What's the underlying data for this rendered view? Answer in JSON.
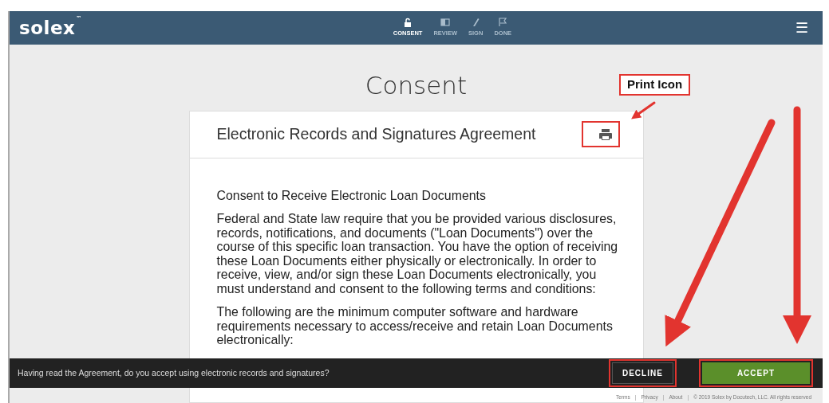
{
  "header": {
    "logo": "solex",
    "trademark": "™",
    "steps": [
      {
        "label": "CONSENT",
        "kind": "lock",
        "selected": true
      },
      {
        "label": "REVIEW",
        "kind": "book",
        "selected": false
      },
      {
        "label": "SIGN",
        "kind": "pen",
        "selected": false
      },
      {
        "label": "DONE",
        "kind": "flag",
        "selected": false
      }
    ],
    "menu": "☰"
  },
  "page_title": "Consent",
  "card": {
    "title": "Electronic Records and Signatures Agreement",
    "heading": "Consent to Receive Electronic Loan Documents",
    "paragraphs": [
      "Federal and State law require that you be provided various disclosures, records, notifications, and documents (\"Loan Documents\") over the course of this specific loan transaction. You have the option of receiving these Loan Documents either physically or electronically. In order to receive, view, and/or sign these Loan Documents electronically, you must understand and consent to the following terms and conditions:",
      "The following are the minimum computer software and hardware requirements necessary to access/receive and retain Loan Documents electronically:"
    ]
  },
  "consent_bar": {
    "question": "Having read the Agreement, do you accept using electronic records and signatures?",
    "buttons": [
      {
        "label": "DECLINE",
        "kind": "decline"
      },
      {
        "label": "ACCEPT",
        "kind": "accept"
      }
    ]
  },
  "footer": {
    "separator": "|",
    "items": [
      "Terms",
      "Privacy",
      "About",
      "© 2019 Solex by Docutech, LLC. All rights reserved"
    ]
  },
  "annotation": {
    "label": "Print Icon"
  }
}
